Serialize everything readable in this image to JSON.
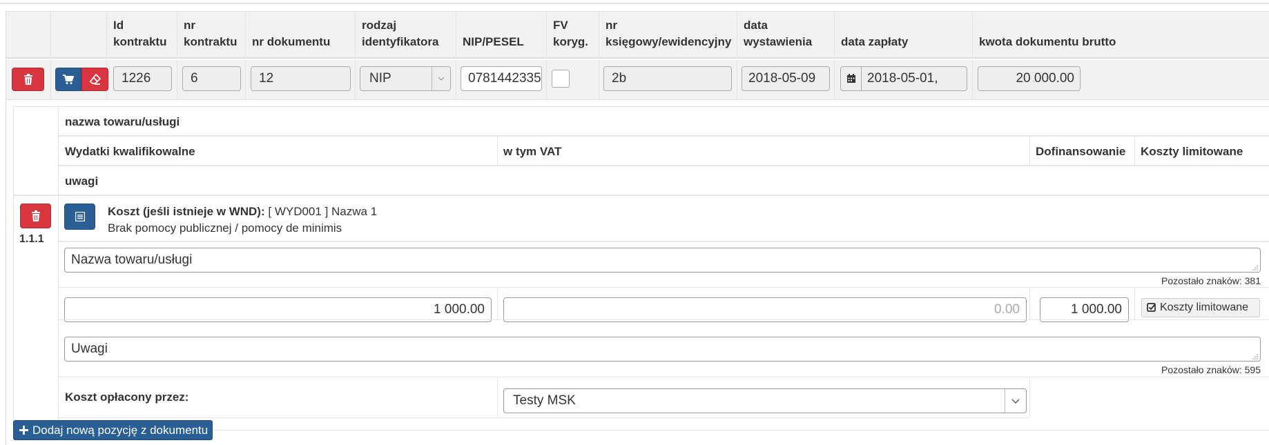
{
  "header": {
    "col_id_kontraktu": "Id kontraktu",
    "col_nr_kontraktu": "nr kontraktu",
    "col_nr_dokumentu": "nr dokumentu",
    "col_rodzaj": "rodzaj identyfikatora",
    "col_nip": "NIP/PESEL",
    "col_fv": "FV koryg.",
    "col_ksiegowy": "nr księgowy/ewidencyjny",
    "col_data_wyst": "data wystawienia",
    "col_data_zapl": "data zapłaty",
    "col_kwota": "kwota dokumentu brutto"
  },
  "row": {
    "id_kontraktu": "1226",
    "nr_kontraktu": "6",
    "nr_dokumentu": "12",
    "rodzaj": "NIP",
    "nip": "0781442335",
    "fv_checked": false,
    "ksiegowy": "2b",
    "data_wyst": "2018-05-09",
    "data_zapl": "2018-05-01,",
    "kwota": "20 000.00"
  },
  "detail_header": {
    "nazwa": "nazwa towaru/usługi",
    "wydatki": "Wydatki kwalifikowalne",
    "vat": "w tym VAT",
    "dofinansowanie": "Dofinansowanie",
    "koszty_lim": "Koszty limitowane",
    "uwagi": "uwagi"
  },
  "item": {
    "number": "1.1.1",
    "koszt_label": "Koszt (jeśli istnieje w WND):",
    "koszt_value": "[ WYD001 ] Nazwa 1",
    "pomoc": "Brak pomocy publicznej / pomocy de minimis",
    "nazwa_placeholder": "Nazwa towaru/usługi",
    "nazwa_remaining": "Pozostało znaków: 381",
    "wydatki_value": "1 000.00",
    "vat_value": "0.00",
    "dofinansowanie_value": "1 000.00",
    "koszty_lim_button": "Koszty limitowane",
    "uwagi_placeholder": "Uwagi",
    "uwagi_remaining": "Pozostało znaków: 595",
    "oplacony_label": "Koszt opłacony przez:",
    "oplacony_value": "Testy MSK"
  },
  "add_button": "Dodaj nową pozycję z dokumentu",
  "icons": {
    "delete": "trash-icon",
    "cart": "cart-icon",
    "eraser": "eraser-icon",
    "calendar": "calendar-icon",
    "list": "list-icon",
    "check": "check-square-icon",
    "plus": "plus-icon"
  },
  "colors": {
    "danger": "#d9353f",
    "primary": "#2a5f96"
  }
}
